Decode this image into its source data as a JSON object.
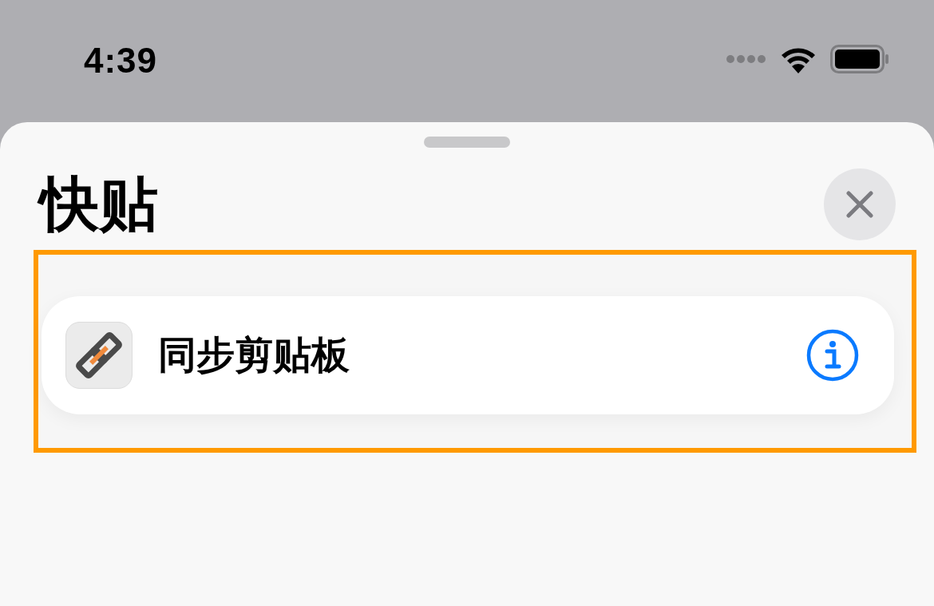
{
  "status_bar": {
    "time": "4:39"
  },
  "sheet": {
    "title": "快贴",
    "shortcuts": [
      {
        "name": "同步剪贴板"
      }
    ]
  }
}
